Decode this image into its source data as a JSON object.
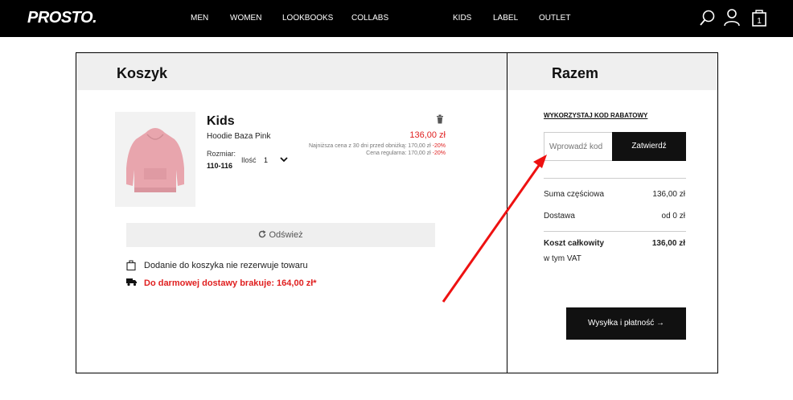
{
  "header": {
    "logo": "PROSTO.",
    "nav": [
      "MEN",
      "WOMEN",
      "LOOKBOOKS",
      "COLLABS",
      "KIDS",
      "LABEL",
      "OUTLET"
    ],
    "cart_count": "1"
  },
  "cart": {
    "title": "Koszyk",
    "item": {
      "name": "Kids",
      "description": "Hoodie Baza Pink",
      "size_label": "Rozmiar:",
      "size_value": "110-116",
      "qty_label": "Ilość",
      "qty_value": "1",
      "price": "136,00 zł",
      "lowest_price_text": "Najniższa cena z 30 dni przed obniżką: 170,00 zł ",
      "lowest_price_discount": "-20%",
      "regular_price_text": "Cena regularna: 170,00 zł ",
      "regular_price_discount": "-20%"
    },
    "refresh_label": "Odśwież",
    "notice_reserve": "Dodanie do koszyka nie rezerwuje towaru",
    "notice_free_shipping": "Do darmowej dostawy brakuje: 164,00 zł*"
  },
  "summary": {
    "title": "Razem",
    "promo_link": "WYKORZYSTAJ KOD RABATOWY",
    "promo_placeholder": "Wprowadź kod",
    "promo_button": "Zatwierdź",
    "subtotal_label": "Suma częściowa",
    "subtotal_value": "136,00 zł",
    "shipping_label": "Dostawa",
    "shipping_value": "od 0 zł",
    "total_label": "Koszt całkowity",
    "total_value": "136,00 zł",
    "vat_label": "w tym VAT",
    "checkout_button": "Wysyłka i płatność →"
  },
  "colors": {
    "accent_red": "#e02020",
    "header_bg": "#000000",
    "button_bg": "#111111",
    "arrow": "#ee1111"
  }
}
